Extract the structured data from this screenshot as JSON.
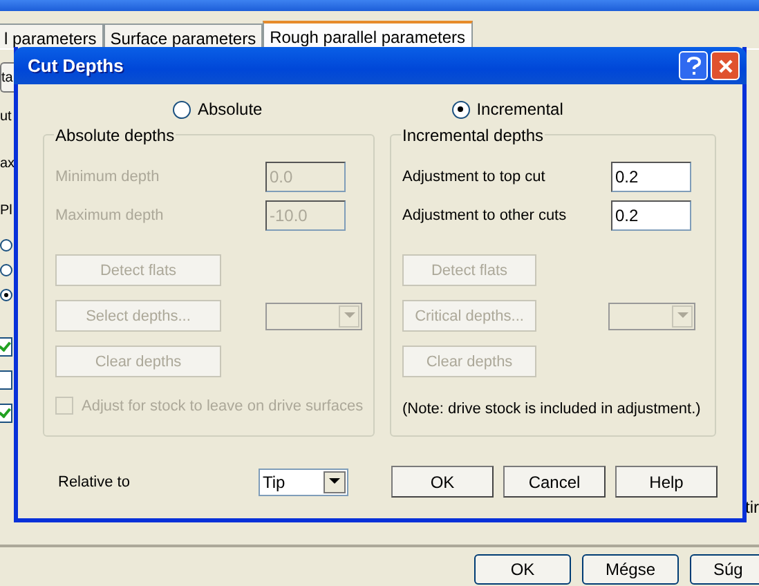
{
  "parent_window": {
    "tabs": [
      {
        "label": "l parameters",
        "selected": false
      },
      {
        "label": "Surface parameters",
        "selected": false
      },
      {
        "label": "Rough parallel parameters",
        "selected": true
      }
    ],
    "left_button": "ta",
    "left_labels": [
      "ut",
      "ax",
      "Pl"
    ],
    "radios": [
      {
        "selected": false
      },
      {
        "selected": false
      },
      {
        "selected": true
      }
    ],
    "checkboxes": [
      {
        "checked": true
      },
      {
        "checked": false
      },
      {
        "checked": true
      }
    ],
    "right_label": "tir",
    "buttons": [
      "OK",
      "Mégse",
      "Súg"
    ]
  },
  "dialog": {
    "title": "Cut Depths",
    "modes": [
      {
        "label": "Absolute",
        "selected": false
      },
      {
        "label": "Incremental",
        "selected": true
      }
    ],
    "absolute_depths": {
      "title": "Absolute depths",
      "fields": [
        {
          "label": "Minimum depth",
          "value": "0.0",
          "disabled": true
        },
        {
          "label": "Maximum depth",
          "value": "-10.0",
          "disabled": true
        }
      ],
      "buttons": [
        {
          "label": "Detect flats",
          "disabled": true
        },
        {
          "label": "Select depths...",
          "disabled": true
        },
        {
          "label": "Clear depths",
          "disabled": true
        }
      ],
      "dropdown": {
        "disabled": true
      },
      "checkbox": {
        "label": "Adjust for stock to leave on drive surfaces",
        "checked": false,
        "disabled": true
      }
    },
    "incremental_depths": {
      "title": "Incremental depths",
      "fields": [
        {
          "label": "Adjustment to top cut",
          "value": "0.2",
          "disabled": false
        },
        {
          "label": "Adjustment to other cuts",
          "value": "0.2",
          "disabled": false
        }
      ],
      "buttons": [
        {
          "label": "Detect flats",
          "disabled": true
        },
        {
          "label": "Critical depths...",
          "disabled": true
        },
        {
          "label": "Clear depths",
          "disabled": true
        }
      ],
      "dropdown": {
        "disabled": true
      },
      "note": "(Note:  drive stock is included in adjustment.)"
    },
    "relative_to": {
      "label": "Relative to",
      "value": "Tip"
    },
    "buttons": [
      "OK",
      "Cancel",
      "Help"
    ]
  }
}
